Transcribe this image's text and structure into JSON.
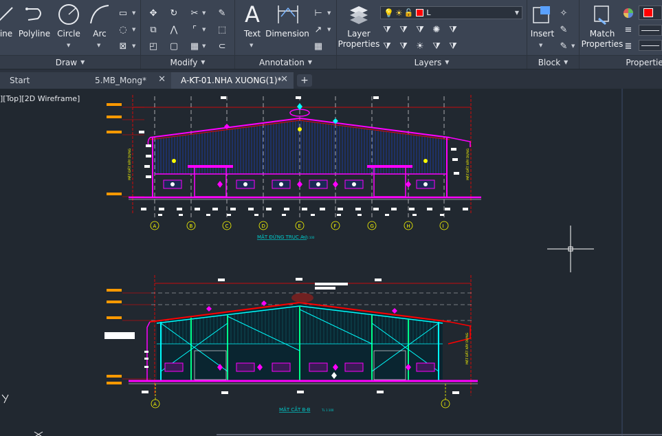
{
  "ribbon": {
    "draw": {
      "title": "Draw",
      "line_label": "ine",
      "polyline_label": "Polyline",
      "circle_label": "Circle",
      "arc_label": "Arc"
    },
    "modify": {
      "title": "Modify"
    },
    "annotation": {
      "title": "Annotation",
      "text_label": "Text",
      "dimension_label": "Dimension"
    },
    "layers": {
      "title": "Layers",
      "layer_properties_label": "Layer\nProperties",
      "current_layer": "L",
      "current_layer_color": "#ff0000"
    },
    "block": {
      "title": "Block",
      "insert_label": "Insert"
    },
    "properties": {
      "title": "Properties",
      "match_label": "Match\nProperties",
      "color_swatch": "#ff0000"
    }
  },
  "tabs": [
    {
      "label": "Start",
      "closable": false
    },
    {
      "label": "5.MB_Mong*",
      "closable": true
    },
    {
      "label": "A-KT-01.NHA XUONG(1)*",
      "closable": true,
      "active": true
    }
  ],
  "viewport": {
    "view_label": "][Top][2D Wireframe]",
    "drawing": {
      "elevation_title": "MẶT ĐỨNG TRỤC A-I",
      "section_title": "MẶT CẮT B-B",
      "scale_note": "TL 1:100",
      "grade_note": "MẶT ĐẤT XÂY DỰNG",
      "axis_labels_top": [
        "A",
        "B",
        "C",
        "D",
        "E",
        "F",
        "G",
        "H",
        "I"
      ],
      "axis_labels_bottom": [
        "A",
        "I"
      ]
    }
  },
  "colors": {
    "ribbon_bg": "#3b4453",
    "canvas_bg": "#212830",
    "magenta": "#ff00ff",
    "cyan": "#00ffff",
    "blue": "#0000ff",
    "red": "#ff0000",
    "yellow": "#ffff00",
    "white": "#ffffff",
    "green": "#00ff00"
  }
}
